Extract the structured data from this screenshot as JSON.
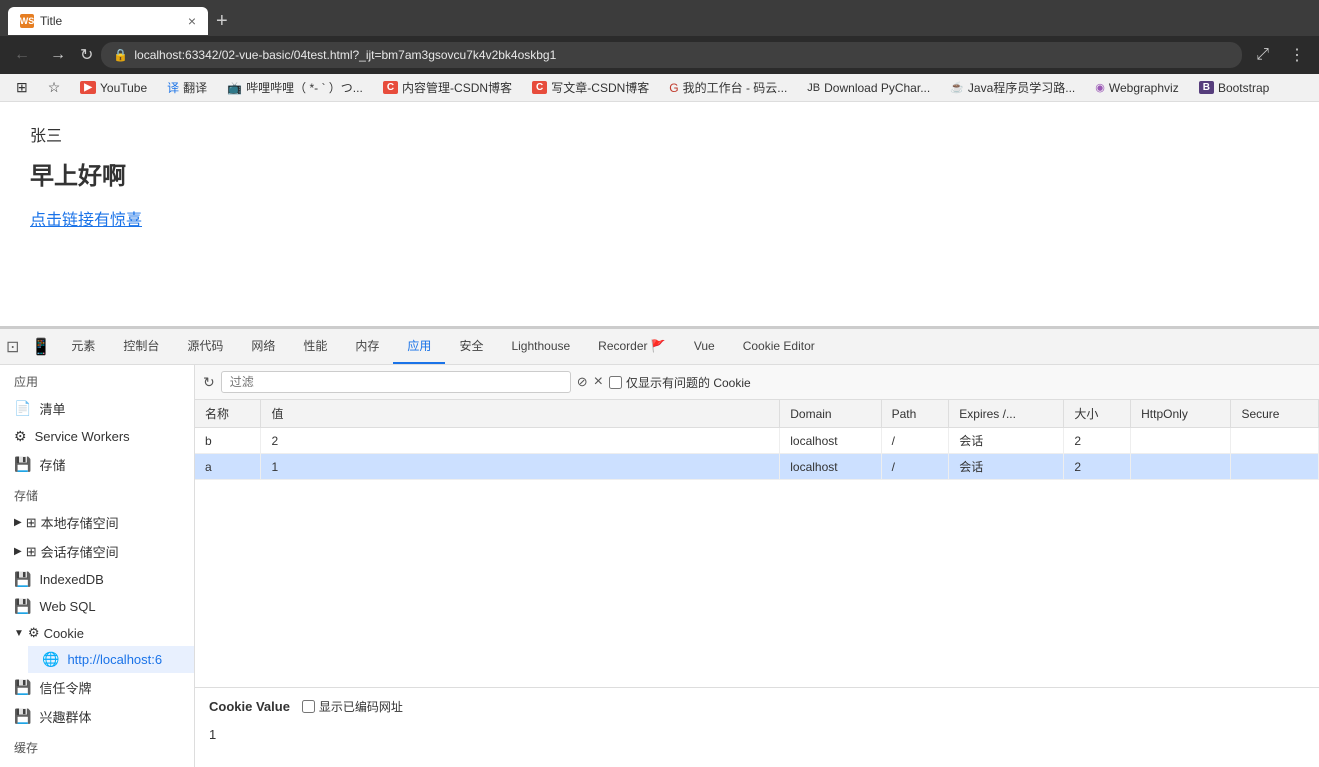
{
  "browser": {
    "tab": {
      "favicon_label": "WS",
      "title": "Title",
      "close_icon": "×",
      "new_tab_icon": "+"
    },
    "nav": {
      "back_icon": "←",
      "forward_icon": "→",
      "reload_icon": "↻",
      "url": "localhost:63342/02-vue-basic/04test.html?_ijt=bm7am3gsovcu7k4v2bk4oskbg1",
      "lock_icon": "🔒",
      "search_icon": "⋮",
      "zoom_icon": "⤢",
      "settings_icon": "⋮"
    },
    "bookmarks": [
      {
        "id": "bm1",
        "icon_color": "#1a73e8",
        "label": ""
      },
      {
        "id": "bm2",
        "icon_color": "#e74c3c",
        "label": ""
      },
      {
        "id": "bm3",
        "icon_color": "#e74c3c",
        "label": "YouTube"
      },
      {
        "id": "bm4",
        "icon_color": "#1a73e8",
        "label": "翻译"
      },
      {
        "id": "bm5",
        "icon_color": "#f39c12",
        "label": "哔哩哔哩（ *- ` ）つ..."
      },
      {
        "id": "bm6",
        "icon_color": "#2ecc71",
        "label": "内容管理-CSDN博客"
      },
      {
        "id": "bm7",
        "icon_color": "#e74c3c",
        "label": "写文章-CSDN博客"
      },
      {
        "id": "bm8",
        "icon_color": "#1a73e8",
        "label": "我的工作台 - 码云..."
      },
      {
        "id": "bm9",
        "icon_color": "#333",
        "label": "Download PyChar..."
      },
      {
        "id": "bm10",
        "icon_color": "#e67e22",
        "label": "Java程序员学习路..."
      },
      {
        "id": "bm11",
        "icon_color": "#9b59b6",
        "label": "Webgraphviz"
      },
      {
        "id": "bm12",
        "icon_color": "#333",
        "label": "Bootstrap"
      }
    ]
  },
  "page": {
    "user": "张三",
    "greeting": "早上好啊",
    "link_text": "点击链接有惊喜"
  },
  "devtools": {
    "tabs": [
      {
        "id": "elements",
        "label": "元素"
      },
      {
        "id": "console",
        "label": "控制台"
      },
      {
        "id": "sources",
        "label": "源代码"
      },
      {
        "id": "network",
        "label": "网络"
      },
      {
        "id": "performance",
        "label": "性能"
      },
      {
        "id": "memory",
        "label": "内存"
      },
      {
        "id": "application",
        "label": "应用",
        "active": true
      },
      {
        "id": "security",
        "label": "安全"
      },
      {
        "id": "lighthouse",
        "label": "Lighthouse"
      },
      {
        "id": "recorder",
        "label": "Recorder 🚩"
      },
      {
        "id": "vue",
        "label": "Vue"
      },
      {
        "id": "cookie-editor",
        "label": "Cookie Editor"
      }
    ],
    "sidebar": {
      "section_app": "应用",
      "items_app": [
        {
          "id": "manifest",
          "icon": "📄",
          "label": "清单"
        },
        {
          "id": "service-workers",
          "icon": "⚙️",
          "label": "Service Workers"
        },
        {
          "id": "storage-item",
          "icon": "💾",
          "label": "存储"
        }
      ],
      "section_storage": "存储",
      "items_storage": [
        {
          "id": "local-storage",
          "icon": "⊞",
          "label": "本地存储空间",
          "expandable": true
        },
        {
          "id": "session-storage",
          "icon": "⊞",
          "label": "会话存储空间",
          "expandable": true
        },
        {
          "id": "indexeddb",
          "icon": "💾",
          "label": "IndexedDB"
        },
        {
          "id": "websql",
          "icon": "💾",
          "label": "Web SQL"
        },
        {
          "id": "cookie",
          "icon": "⚙️",
          "label": "Cookie",
          "expandable": true,
          "expanded": true,
          "children": [
            {
              "id": "cookie-localhost",
              "label": "http://localhost:6"
            }
          ]
        }
      ],
      "items_storage2": [
        {
          "id": "trust-token",
          "icon": "💾",
          "label": "信任令牌"
        },
        {
          "id": "interest-group",
          "icon": "💾",
          "label": "兴趣群体"
        }
      ],
      "section_cache": "缓存"
    },
    "filter_placeholder": "过滤",
    "filter_refresh_icon": "↻",
    "filter_funnel_icon": "⊘",
    "filter_clear_icon": "×",
    "show_issues_label": "仅显示有问题的 Cookie",
    "table": {
      "columns": [
        "名称",
        "值",
        "Domain",
        "Path",
        "Expires /...",
        "大小",
        "HttpOnly",
        "Secure"
      ],
      "rows": [
        {
          "id": "row-b",
          "name": "b",
          "value": "2",
          "domain": "localhost",
          "path": "/",
          "expires": "会话",
          "size": "2",
          "http_only": "",
          "secure": "",
          "selected": false
        },
        {
          "id": "row-a",
          "name": "a",
          "value": "1",
          "domain": "localhost",
          "path": "/",
          "expires": "会话",
          "size": "2",
          "http_only": "",
          "secure": "",
          "selected": true
        }
      ]
    },
    "cookie_value_panel": {
      "label": "Cookie Value",
      "show_encoded_label": "显示已编码网址",
      "value": "1"
    }
  }
}
